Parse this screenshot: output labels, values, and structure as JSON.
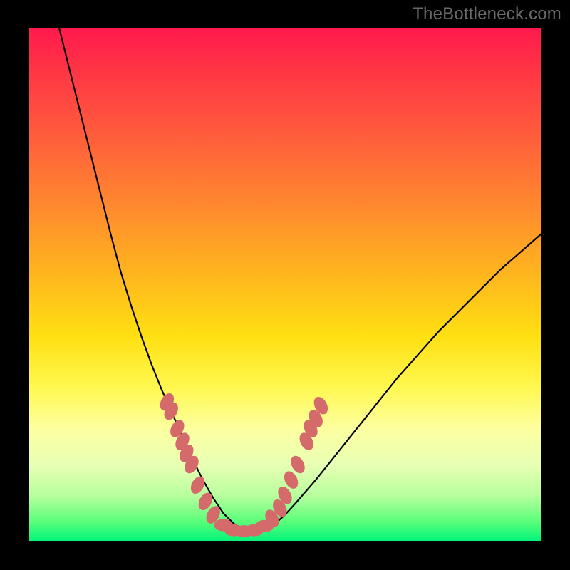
{
  "watermark": "TheBottleneck.com",
  "colors": {
    "frame": "#000000",
    "gradient_top": "#ff1a4d",
    "gradient_mid1": "#ff8a2e",
    "gradient_mid2": "#ffe012",
    "gradient_mid3": "#fdffa0",
    "gradient_bottom": "#00f47a",
    "curve": "#000000",
    "markers": "#d46a6a"
  },
  "chart_data": {
    "type": "line",
    "title": "",
    "xlabel": "",
    "ylabel": "",
    "xlim": [
      0,
      100
    ],
    "ylim": [
      0,
      100
    ],
    "grid": false,
    "description": "Bottleneck-style V curve: percentage mismatch (y, 0=good at bottom, 100=bad at top) vs. relative component balance (x). Minimum near x≈34–42 at y≈2. Left branch rises steeply toward y≈100 at x≈6; right branch rises more gently toward y≈60 at x≈100.",
    "series": [
      {
        "name": "bottleneck-curve",
        "x": [
          6,
          8,
          10,
          12,
          14,
          16,
          18,
          20,
          22,
          24,
          26,
          28,
          30,
          32,
          34,
          36,
          38,
          40,
          42,
          44,
          46,
          48,
          50,
          52,
          56,
          60,
          64,
          68,
          72,
          76,
          80,
          84,
          88,
          92,
          96,
          100
        ],
        "y": [
          100,
          92,
          84,
          76,
          68,
          60,
          52.5,
          46,
          40,
          34.5,
          29.5,
          25,
          20.5,
          16,
          12,
          8.5,
          5.5,
          3.5,
          2.3,
          2.0,
          2.3,
          3.4,
          5.2,
          7.4,
          12.0,
          17.0,
          22.0,
          27.0,
          32.0,
          36.5,
          41.0,
          45.0,
          49.0,
          53.0,
          56.5,
          60.0
        ]
      }
    ],
    "markers": {
      "name": "highlighted-points",
      "note": "lozenge markers clustered on both branches between roughly y=5 and y=28, plus flat bottom y≈2",
      "x": [
        27.0,
        27.8,
        29.0,
        30.0,
        30.8,
        31.8,
        33.0,
        34.5,
        36.0,
        38.0,
        40.0,
        42.0,
        44.0,
        46.0,
        47.5,
        49.0,
        50.0,
        51.2,
        52.5,
        54.2,
        55.0,
        56.0,
        57.0
      ],
      "y": [
        27.2,
        25.4,
        22.0,
        19.5,
        17.2,
        15.0,
        11.0,
        7.8,
        5.2,
        3.2,
        2.2,
        2.0,
        2.2,
        3.0,
        4.5,
        6.5,
        9.0,
        12.0,
        15.0,
        19.5,
        22.0,
        24.0,
        26.5
      ]
    }
  }
}
